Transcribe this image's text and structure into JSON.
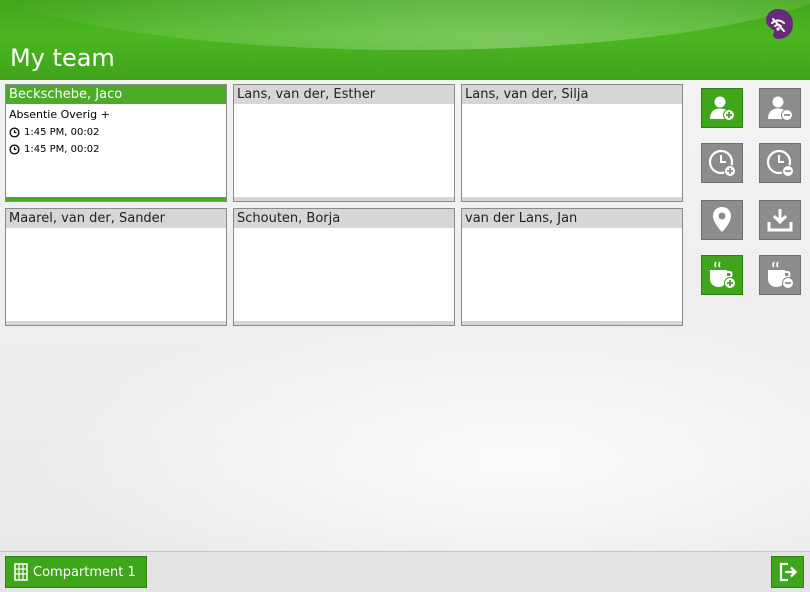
{
  "header": {
    "title": "My team",
    "logo_icon": "wifi-off-icon"
  },
  "colors": {
    "accent": "#3fa51a",
    "button_gray": "#8c8c8c",
    "logo": "#6a2a7a"
  },
  "team_cards": [
    {
      "name": "Beckschebe, Jaco",
      "active": true,
      "status": "Absentie Overig +",
      "times": [
        "1:45 PM, 00:02",
        "1:45 PM, 00:02"
      ]
    },
    {
      "name": "Lans, van der, Esther",
      "active": false
    },
    {
      "name": "Lans, van der, Silja",
      "active": false
    },
    {
      "name": "Maarel, van der, Sander",
      "active": false
    },
    {
      "name": "Schouten, Borja",
      "active": false
    },
    {
      "name": "van der Lans, Jan",
      "active": false
    }
  ],
  "actions": [
    {
      "icon": "user-add-icon",
      "style": "green"
    },
    {
      "icon": "user-remove-icon",
      "style": "gray"
    },
    {
      "icon": "clock-add-icon",
      "style": "gray"
    },
    {
      "icon": "clock-remove-icon",
      "style": "gray"
    },
    {
      "icon": "location-pin-icon",
      "style": "gray"
    },
    {
      "icon": "download-icon",
      "style": "gray"
    },
    {
      "icon": "coffee-add-icon",
      "style": "green"
    },
    {
      "icon": "coffee-remove-icon",
      "style": "gray"
    }
  ],
  "footer": {
    "compartment_label": "Compartment 1",
    "compartment_icon": "grid-icon",
    "exit_icon": "exit-icon"
  }
}
